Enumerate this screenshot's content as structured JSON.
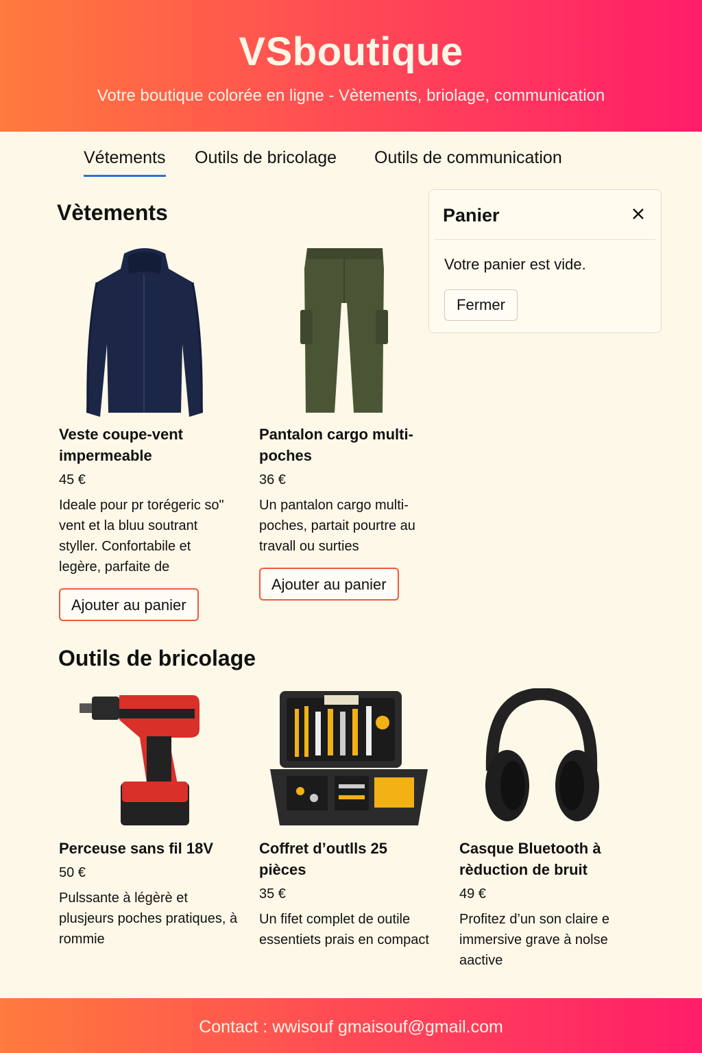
{
  "header": {
    "brand": "VSboutique",
    "tagline": "Votre boutique colorée en ligne - Vètements, briolage, communication"
  },
  "nav": {
    "tabs": [
      {
        "label": "Vétements",
        "active": true
      },
      {
        "label": "Outils de bricolage",
        "active": false
      },
      {
        "label": "Outils de communication",
        "active": false
      }
    ]
  },
  "sections": {
    "clothing": {
      "title": "Vètements",
      "products": [
        {
          "name": "Veste coupe-vent impermeable",
          "price": "45 €",
          "description": "Ideale pour pr torégeric so\" vent et la bluu soutrant styller.  Confortabile et legère, parfaite de",
          "button": "Ajouter au panier",
          "icon": "jacket-image"
        },
        {
          "name": "Pantalon cargo multi-poches",
          "price": "36 €",
          "description": "Un pantalon cargo multi-poches, partait pourtre au travall ou surties",
          "button": "Ajouter au panier",
          "icon": "cargo-pants-image"
        }
      ]
    },
    "tools": {
      "title": "Outils de bricolage",
      "products": [
        {
          "name": "Perceuse sans fil 18V",
          "price": "50 €",
          "description": "Pulssante à légèrè et plusjeurs poches pratiques, à rommie",
          "icon": "drill-image"
        },
        {
          "name": "Coffret d’outlls 25 pièces",
          "price": "35 €",
          "description": "Un fifet complet de outile essentiets prais en compact",
          "icon": "toolbox-image"
        },
        {
          "name": "Casque Bluetooth à rèduction de bruit",
          "price": "49 €",
          "description": "Profitez d’un son claire e immersive grave à nolse aactive",
          "icon": "headphones-image"
        }
      ]
    }
  },
  "cart": {
    "title": "Panier",
    "empty_message": "Votre panier est vide.",
    "close_button": "Fermer"
  },
  "footer": {
    "contact": "Contact :  wwisouf gmaisouf@gmail.com"
  },
  "colors": {
    "accent_orange": "#ff7a3d",
    "accent_pink": "#ff1d6a",
    "tab_underline": "#2f6fd0",
    "button_border": "#ef5a3a",
    "background": "#fdf8e8"
  }
}
